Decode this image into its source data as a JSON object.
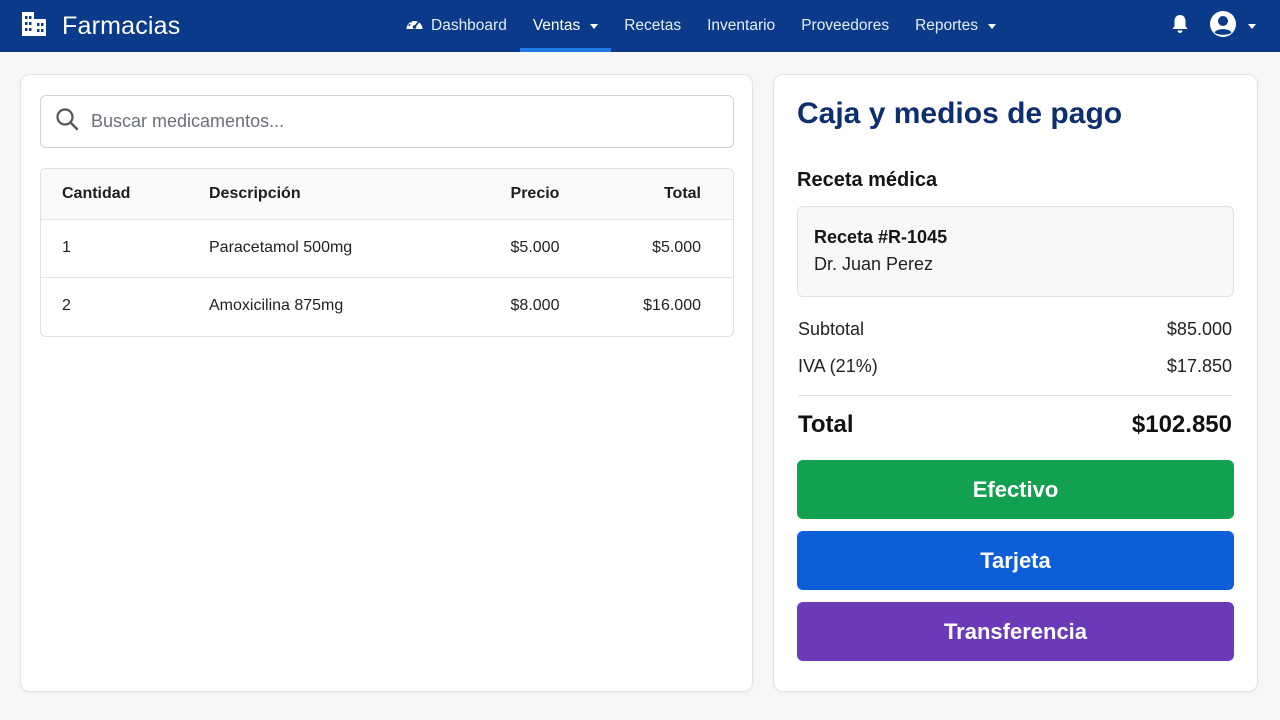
{
  "navbar": {
    "brand": "Farmacias",
    "items": [
      {
        "label": "Dashboard"
      },
      {
        "label": "Ventas"
      },
      {
        "label": "Recetas"
      },
      {
        "label": "Inventario"
      },
      {
        "label": "Proveedores"
      },
      {
        "label": "Reportes"
      }
    ],
    "active": "Ventas",
    "bg_color": "#0b3a8a",
    "active_underline_color": "#1f7ae8"
  },
  "search": {
    "placeholder": "Buscar medicamentos...",
    "value": ""
  },
  "table": {
    "columns": [
      "Cantidad",
      "Descripción",
      "Precio",
      "Total"
    ],
    "rows": [
      {
        "cantidad": "1",
        "descripcion": "Paracetamol 500mg",
        "precio": "$5.000",
        "total": "$5.000"
      },
      {
        "cantidad": "2",
        "descripcion": "Amoxicilina 875mg",
        "precio": "$8.000",
        "total": "$16.000"
      }
    ]
  },
  "checkout": {
    "title": "Caja y medios de pago",
    "receta_heading": "Receta médica",
    "receta_number": "Receta #R-1045",
    "receta_doctor": "Dr. Juan Perez",
    "subtotal_label": "Subtotal",
    "subtotal_value": "$85.000",
    "iva_label": "IVA (21%)",
    "iva_value": "$17.850",
    "total_label": "Total",
    "total_value": "$102.850",
    "buttons": {
      "efectivo": "Efectivo",
      "tarjeta": "Tarjeta",
      "transferencia": "Transferencia"
    },
    "colors": {
      "efectivo": "#12a150",
      "tarjeta": "#0d5fd9",
      "transferencia": "#6a3ab8",
      "title": "#0e2f6e"
    }
  },
  "icons": [
    "building-icon",
    "dashboard-gauge-icon",
    "caret-down-icon",
    "bell-icon",
    "user-avatar-icon",
    "search-icon"
  ]
}
